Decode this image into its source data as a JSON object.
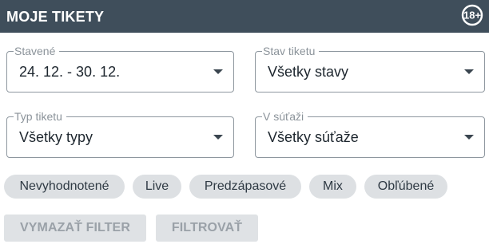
{
  "header": {
    "title": "MOJE TIKETY",
    "age_badge": "18+",
    "background_color": "#3f4e5b"
  },
  "filters": {
    "stavene": {
      "label": "Stavené",
      "value": "24. 12. - 30. 12."
    },
    "stav_tiketu": {
      "label": "Stav tiketu",
      "value": "Všetky stavy"
    },
    "typ_tiketu": {
      "label": "Typ tiketu",
      "value": "Všetky typy"
    },
    "v_sutazi": {
      "label": "V súťaži",
      "value": "Všetky súťaže"
    }
  },
  "chips": [
    {
      "label": "Nevyhodnotené"
    },
    {
      "label": "Live"
    },
    {
      "label": "Predzápasové"
    },
    {
      "label": "Mix"
    },
    {
      "label": "Obľúbené"
    }
  ],
  "actions": {
    "clear_label": "VYMAZAŤ FILTER",
    "filter_label": "FILTROVAŤ"
  },
  "icons": {
    "dropdown": "caret-down-icon",
    "age": "age-restriction-18-icon"
  }
}
